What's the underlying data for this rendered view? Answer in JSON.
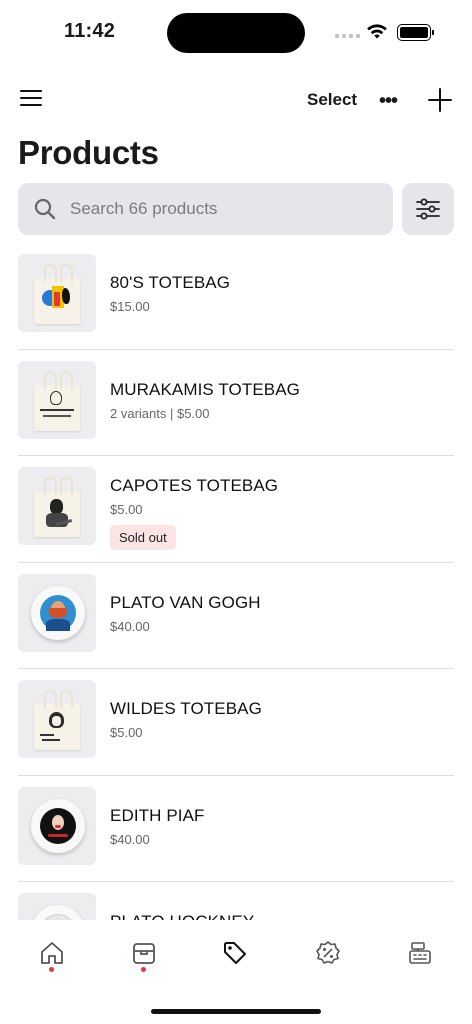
{
  "status_bar": {
    "time": "11:42"
  },
  "nav": {
    "select_label": "Select",
    "more_label": "•••"
  },
  "page": {
    "title": "Products"
  },
  "search": {
    "placeholder": "Search 66 products"
  },
  "products": [
    {
      "name": "80'S TOTEBAG",
      "meta": "$15.00",
      "thumb": "bag",
      "badge": ""
    },
    {
      "name": "MURAKAMIS TOTEBAG",
      "meta": "2 variants | $5.00",
      "thumb": "bag",
      "badge": ""
    },
    {
      "name": "CAPOTES TOTEBAG",
      "meta": "$5.00",
      "thumb": "bag",
      "badge": "Sold out"
    },
    {
      "name": "PLATO VAN GOGH",
      "meta": "$40.00",
      "thumb": "plate",
      "badge": ""
    },
    {
      "name": "WILDES TOTEBAG",
      "meta": "$5.00",
      "thumb": "bag",
      "badge": ""
    },
    {
      "name": "EDITH PIAF",
      "meta": "$40.00",
      "thumb": "plate",
      "badge": ""
    },
    {
      "name": "PLATO HOCKNEY",
      "meta": "",
      "thumb": "plate",
      "badge": ""
    }
  ],
  "tabs": [
    {
      "icon": "home-icon",
      "has_dot": true
    },
    {
      "icon": "orders-box-icon",
      "has_dot": true
    },
    {
      "icon": "tag-icon",
      "has_dot": false,
      "active": true
    },
    {
      "icon": "discount-icon",
      "has_dot": false
    },
    {
      "icon": "cash-register-icon",
      "has_dot": false
    }
  ],
  "colors": {
    "accent_dot": "#e53935",
    "badge_bg": "#fde4e4",
    "search_bg": "#e6e6ea"
  }
}
